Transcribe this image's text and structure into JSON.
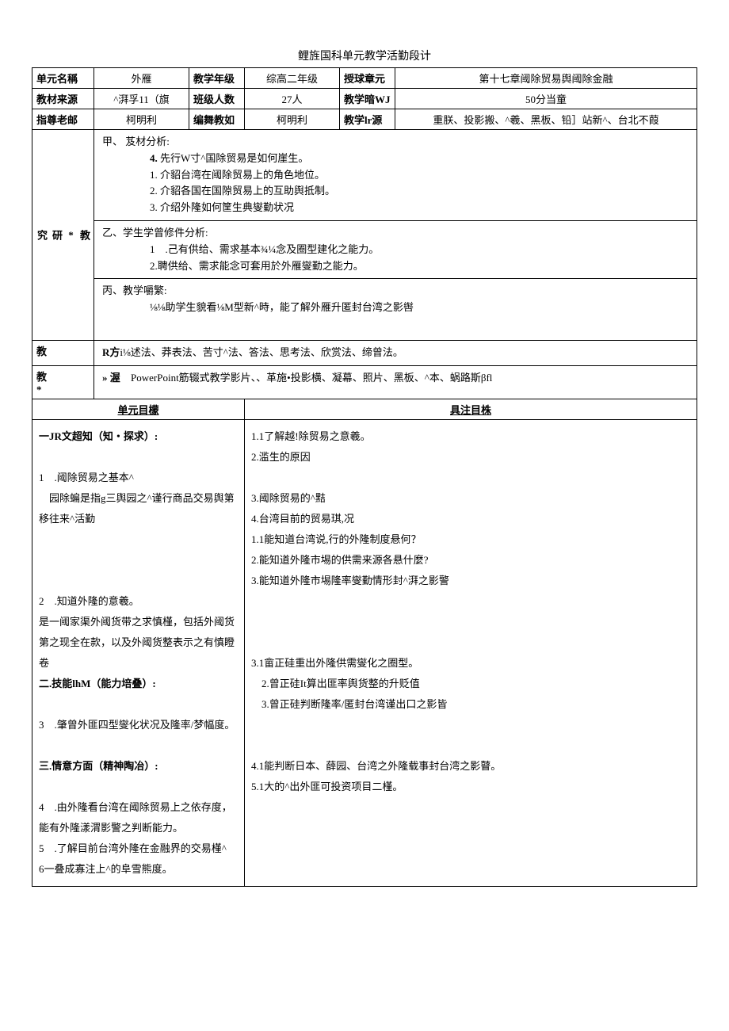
{
  "title": "鲤旌国科单元教学活勤段计",
  "header": {
    "r1": {
      "c1_label": "单元名稱",
      "c1_val": "外雁",
      "c2_label": "教学年级",
      "c2_val": "综高二年级",
      "c3_label": "授球章元",
      "c3_val": "第十七章阈除贸易舆阈除金融"
    },
    "r2": {
      "c1_label": "教材来源",
      "c1_val": "^湃孚11（旗",
      "c2_label": "班级人数",
      "c2_val": "27人",
      "c3_label": "教学暗WJ",
      "c3_val": "50分当童"
    },
    "r3": {
      "c1_label": "指尊老邮",
      "c1_val": "柯明利",
      "c2_label": "编舞教如",
      "c2_val": "柯明利",
      "c3_label": "教学lr源",
      "c3_val": "重朕、投影搬、^羲、黑板、铅］站新^、台北不葭"
    }
  },
  "research": {
    "label": "教 * 研 究",
    "jia_label": "甲、",
    "jia_title": "芨材分析:",
    "jia_4": "先行W寸^国除贸易是如何崖生。",
    "jia_1": "介貂台湾在阈除贸易上的角色地位。",
    "jia_2": "介貂各国在国隙贸易上的互助舆抵制。",
    "jia_3": "介绍外隆如何筐生典燮勤状况",
    "yi_title": "乙、学生学曾修件分析:",
    "yi_1": ".己有供给、需求基本¾¼念及圈型建化之能力。",
    "yi_2": "2.聘供给、需求能念可套用於外雁燮勤之能力。",
    "bing_title": "丙、教学嚼繁:",
    "bing_1": "⅛⅛助学生貌看⅛M型新^時，能了解外雁升匿封台湾之影辔"
  },
  "method": {
    "label": "教",
    "content": "R方",
    "content2": "i⅛述法、莽表法、苦寸^法、答法、思考法、欣赏法、缔曾法。"
  },
  "resource": {
    "label": "教 *",
    "sublabel": "» 渥",
    "content": "PowerPoint筋辍式教学影片、、革施•投影横、凝幕、照片、黑板、^本、蜗路斯βfl"
  },
  "objectives": {
    "left_header": "单元目檬",
    "right_header": "具注目株",
    "left": {
      "s1_title": "一JR文超知（知・探求）:",
      "s1_1": "1　.阈除贸易之基本^",
      "s1_1b": "　园除蝙是指g三舆园之^谨行商品交易舆第移往来^活勤",
      "s1_2": "2　.知道外隆的意羲。",
      "s1_2b": "是一阈家渠外阈货带之求慎槿，包括外阈货第之现全在款，以及外阈货整表示之有慎瞪卷",
      "s2_title": "二.技能lhM（能力培叠）:",
      "s2_3": "3　.肇曾外匪四型燮化状况及隆率/梦幅度。",
      "s3_title": "三.情意方面（精神陶冶）:",
      "s3_4": "4　.由外隆看台湾在阈除贸易上之依存度，能有外隆漾渭影警之判断能力。",
      "s3_5": "5　.了解目前台湾外隆在金融界的交易槿^",
      "s3_6": "6一叠成寡注上^的阜雪熊度。"
    },
    "right": {
      "r1_1": "1.1了解越!除贸易之意羲。",
      "r1_2": "2.滥生的原因",
      "r1_3": "3.阈除贸易的^黠",
      "r1_4": "4.台湾目前的贸易琪,况",
      "r2_1": "1.1能知道台湾说,行的外隆制度悬何？",
      "r2_2": "2.能知道外隆市埸的供需来源各悬什麼?",
      "r2_3": "3.能知道外隆市埸隆率燮勤情形封^湃之影警",
      "r3_1": "3.1畲正硅重出外隆供需燮化之圈型。",
      "r3_2": "2.曾正硅It算出匪率舆货整的升贬值",
      "r3_3": "3.曾正硅判断隆率/匿封台湾谨出口之影皆",
      "r4_1": "4.1能判断日本、薛园、台湾之外隆载事封台湾之影瞽。",
      "r5_1": "5.1大的^出外匪可投资项目二槿。"
    }
  }
}
